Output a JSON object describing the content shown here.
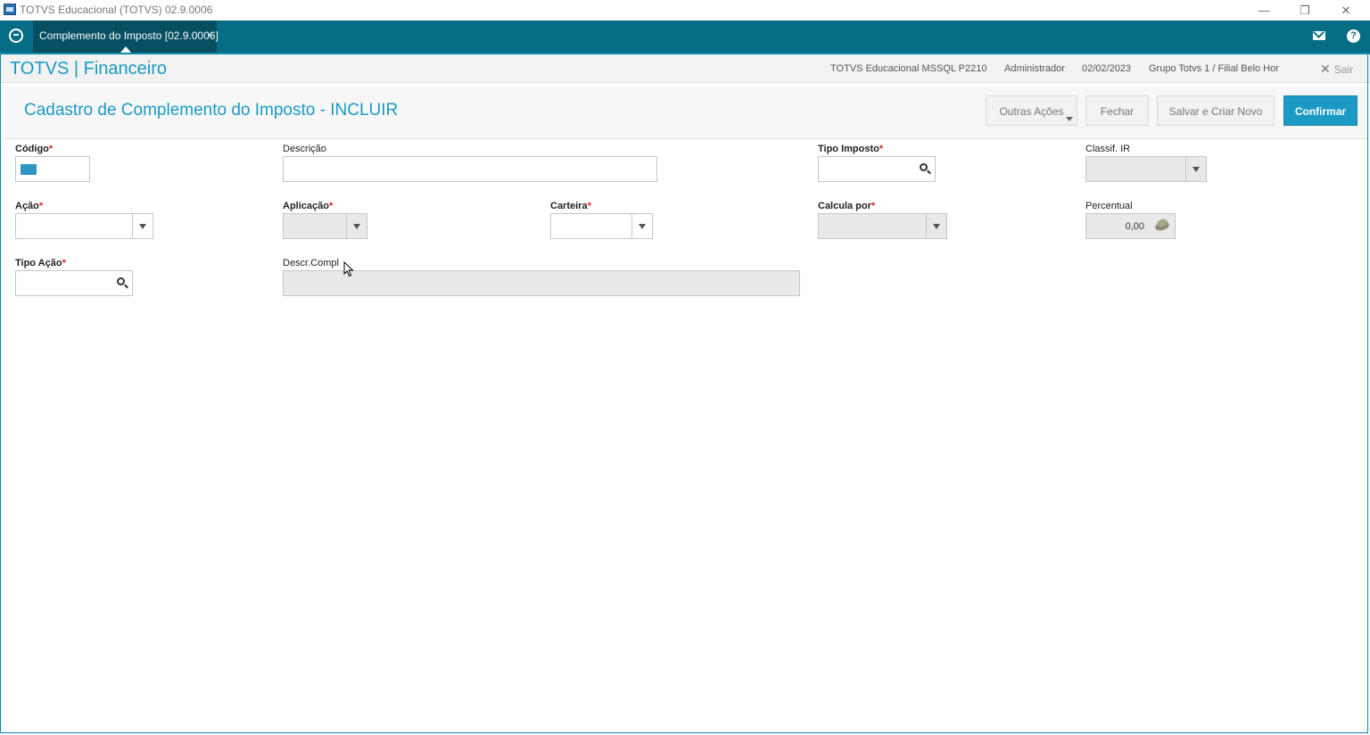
{
  "window": {
    "title": "TOTVS Educacional (TOTVS) 02.9.0006",
    "minimize": "—",
    "restore": "❐",
    "close": "✕"
  },
  "tabbar": {
    "tab_label": "Complemento do Imposto [02.9.0006]",
    "tab_close": "×",
    "help": "?"
  },
  "header": {
    "brand": "TOTVS | Financeiro",
    "server": "TOTVS Educacional MSSQL P2210",
    "user": "Administrador",
    "date": "02/02/2023",
    "branch": "Grupo Totvs 1 / Filial Belo Hor",
    "logout": "Sair",
    "logout_icon": "✕"
  },
  "page": {
    "title": "Cadastro de Complemento do Imposto - INCLUIR",
    "buttons": {
      "other_actions": "Outras Ações",
      "close": "Fechar",
      "save_new": "Salvar e Criar Novo",
      "confirm": "Confirmar"
    }
  },
  "form": {
    "required_mark": "*",
    "codigo": {
      "label": "Código",
      "value": ""
    },
    "descricao": {
      "label": "Descrição",
      "value": ""
    },
    "tipo_imposto": {
      "label": "Tipo Imposto",
      "value": ""
    },
    "classif_ir": {
      "label": "Classif. IR",
      "value": ""
    },
    "acao": {
      "label": "Ação",
      "value": ""
    },
    "aplicacao": {
      "label": "Aplicação",
      "value": ""
    },
    "carteira": {
      "label": "Carteira",
      "value": ""
    },
    "calcula_por": {
      "label": "Calcula por",
      "value": ""
    },
    "percentual": {
      "label": "Percentual",
      "value": "0,00"
    },
    "tipo_acao": {
      "label": "Tipo Ação",
      "value": ""
    },
    "descr_compl": {
      "label": "Descr.Compl",
      "value": ""
    }
  }
}
